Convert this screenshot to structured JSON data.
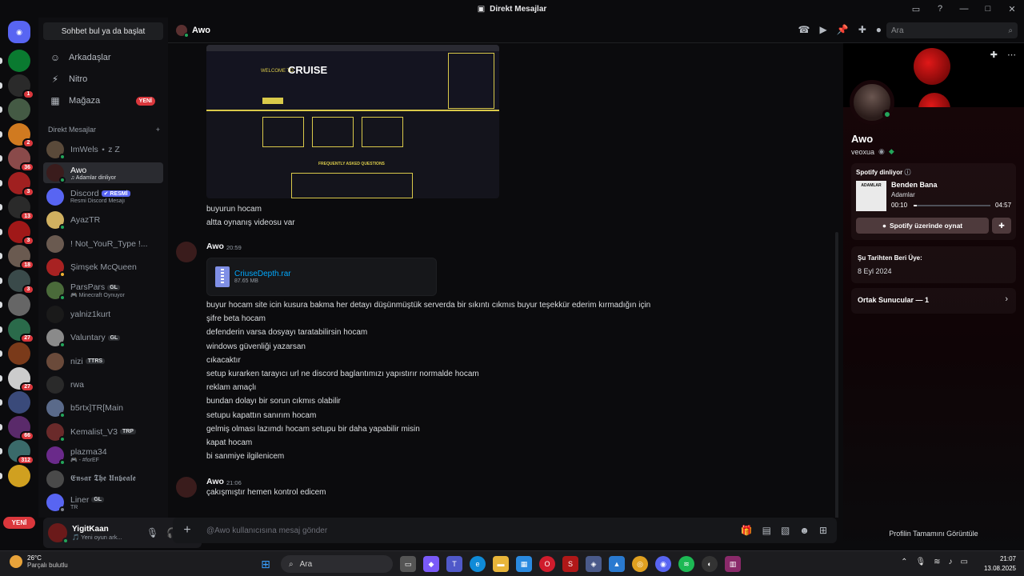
{
  "window": {
    "title": "Direkt Mesajlar"
  },
  "rail": {
    "badges": [
      "1",
      "2",
      "36",
      "3",
      "13",
      "3",
      "18",
      "3",
      "27",
      "27",
      "66",
      "312"
    ],
    "new_label": "YENİ"
  },
  "sidebar": {
    "search_label": "Sohbet bul ya da başlat",
    "nav": [
      {
        "label": "Arkadaşlar",
        "icon": "friends-icon"
      },
      {
        "label": "Nitro",
        "icon": "nitro-icon"
      },
      {
        "label": "Mağaza",
        "icon": "shop-icon",
        "badge": "YENİ"
      }
    ],
    "dm_header": "Direkt Mesajlar",
    "dm_add": "+",
    "dms": [
      {
        "name": "ImWels ⋆ z Z",
        "sub": "",
        "color": "#5a4a3a",
        "status": "#23a55a"
      },
      {
        "name": "Awo",
        "sub": "♫ Adamlar dinliyor",
        "color": "#3a1c1c",
        "status": "#23a55a",
        "active": true
      },
      {
        "name": "Discord",
        "tag": "✔ RESMİ",
        "sub": "Resmi Discord Mesajı",
        "color": "#5865f2"
      },
      {
        "name": "AyazTR",
        "sub": "",
        "color": "#d0b060",
        "status": "#23a55a"
      },
      {
        "name": "! Not_YouR_Type !...",
        "sub": "",
        "color": "#6a5a50"
      },
      {
        "name": "Şimşek McQueen",
        "sub": "",
        "color": "#a82222",
        "status": "#f0b232"
      },
      {
        "name": "ParsPars",
        "tag": "GL",
        "sub": "🎮 Minecraft Oynuyor",
        "color": "#4a6a3a",
        "status": "#23a55a"
      },
      {
        "name": "yalniz1kurt",
        "sub": "",
        "color": "#1a1a1a"
      },
      {
        "name": "Valuntary",
        "tag": "GL",
        "sub": "",
        "color": "#8a8a8a",
        "status": "#23a55a"
      },
      {
        "name": "nizi",
        "tag": "TTRS",
        "sub": "",
        "color": "#6a4a3a"
      },
      {
        "name": "rwa",
        "sub": "",
        "color": "#2a2a2a"
      },
      {
        "name": "b5rtx]TR[Main",
        "sub": "",
        "color": "#5a6a8a",
        "status": "#23a55a"
      },
      {
        "name": "Kemalist_V3",
        "tag": "TRP",
        "sub": "",
        "color": "#6a2a2a",
        "status": "#23a55a"
      },
      {
        "name": "plazma34",
        "sub": "🎮 - #forEF",
        "color": "#6a2a8a",
        "status": "#23a55a"
      },
      {
        "name": "𝕰𝖓𝖘𝖆𝖗 𝕿𝖍𝖊 𝖀𝖓𝖇𝖊𝖆𝖑𝖊",
        "sub": "",
        "color": "#4a4a4a"
      },
      {
        "name": "Liner",
        "tag": "GL",
        "sub": "TR",
        "color": "#5865f2",
        "status": "#80848e"
      }
    ]
  },
  "user_panel": {
    "name": "YigitKaan",
    "status": "🎵 Yeni oyun ark..."
  },
  "chat": {
    "recipient": "Awo",
    "search_placeholder": "Ara",
    "composer_placeholder": "@Awo kullanıcısına mesaj gönder",
    "embed": {
      "welcome": "WELCOME TO",
      "title": "CRUISE",
      "faq": "FREQUENTLY ASKED QUESTIONS"
    },
    "lines_before": [
      "buyurun hocam",
      "altta oynanış videosu var"
    ],
    "group2": {
      "author": "Awo",
      "time": "20:59",
      "file_name": "CriuseDepth.rar",
      "file_size": "87.65 MB",
      "lines": [
        "buyur hocam site icin kusura bakma her detayı düşünmüştük serverda bir sıkıntı cıkmıs buyur teşekkür ederim kırmadığın için",
        "şifre beta hocam",
        "defenderin varsa dosyayı taratabilirsin hocam",
        "windows güvenliği yazarsan",
        "cıkacaktır",
        "setup kurarken tarayıcı url ne discord baglantımızı yapıstırır normalde hocam",
        "reklam amaçlı",
        "bundan dolayı bir sorun cıkmıs olabilir",
        "setupu kapattın sanırım hocam",
        "gelmiş olması lazımdı hocam setupu bir daha yapabilir misin",
        "kapat hocam",
        "bi sanmiye ilgilenicem"
      ]
    },
    "group3": {
      "author": "Awo",
      "time": "21:06",
      "lines": [
        "çakışmıştır hemen kontrol edicem"
      ]
    }
  },
  "profile": {
    "display_name": "Awo",
    "username": "veoxua",
    "spotify": {
      "header": "Spotify dinliyor",
      "art_text": "ADAMLAR",
      "song": "Benden Bana",
      "artist": "Adamlar",
      "elapsed": "00:10",
      "duration": "04:57",
      "progress": 0.04,
      "play_button": "Spotify üzerinde oynat"
    },
    "member_since_label": "Şu Tarihten Beri Üye:",
    "member_since": "8 Eyl 2024",
    "mutual_servers": "Ortak Sunucular — 1",
    "full_profile": "Profilin Tamamını Görüntüle"
  },
  "taskbar": {
    "temp": "26°C",
    "weather": "Parçalı bulutlu",
    "search": "Ara",
    "time": "21:07",
    "date": "13.08.2025"
  }
}
